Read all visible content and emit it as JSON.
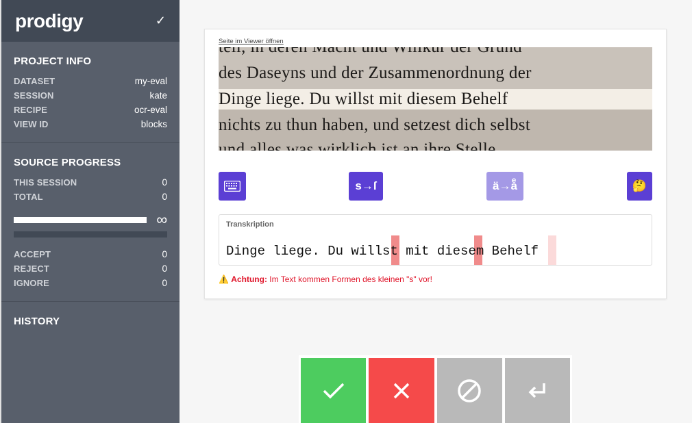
{
  "app": {
    "logo": "prodigy"
  },
  "project_info": {
    "title": "PROJECT INFO",
    "rows": [
      {
        "k": "DATASET",
        "v": "my-eval"
      },
      {
        "k": "SESSION",
        "v": "kate"
      },
      {
        "k": "RECIPE",
        "v": "ocr-eval"
      },
      {
        "k": "VIEW ID",
        "v": "blocks"
      }
    ]
  },
  "source_progress": {
    "title": "SOURCE PROGRESS",
    "rows": [
      {
        "k": "THIS SESSION",
        "v": "0"
      },
      {
        "k": "TOTAL",
        "v": "0"
      }
    ],
    "infinity": "∞",
    "counts": [
      {
        "k": "ACCEPT",
        "v": "0"
      },
      {
        "k": "REJECT",
        "v": "0"
      },
      {
        "k": "IGNORE",
        "v": "0"
      }
    ]
  },
  "history": {
    "title": "HISTORY"
  },
  "card": {
    "viewer_link": "Seite im Viewer öffnen",
    "scan_lines": [
      "teil, in deren Macht und Willkür der Grund",
      "des Daseyns und der Zusammenordnung der",
      "Dinge liege.   Du willst mit diesem Behelf",
      "nichts zu thun haben, und setzest dich selbst",
      "und alles was wirklich ist an ihre Stelle"
    ],
    "buttons": {
      "s_label": "s→ſ",
      "a_label": "ä→aͤ",
      "think_emoji": "🤔"
    },
    "transcription": {
      "label": "Transkription",
      "text": "Dinge liege. Du willst mit diesem Behelf"
    },
    "warning": {
      "prefix": "Achtung:",
      "text": " Im Text kommen Formen des kleinen \"s\" vor!"
    }
  },
  "colors": {
    "accent": "#5b3fd4",
    "accept": "#4dcc5f",
    "reject": "#f54a4a",
    "ignore": "#b9b9b9"
  }
}
